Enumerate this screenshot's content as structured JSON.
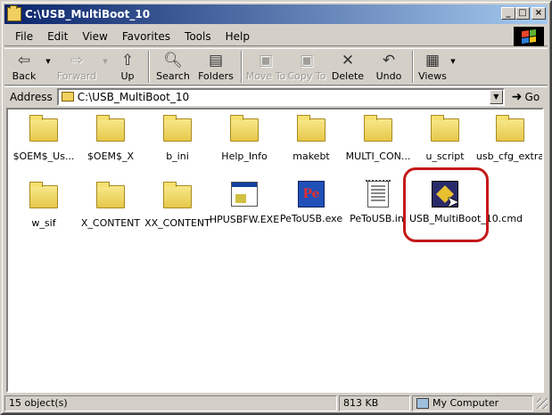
{
  "window": {
    "title": "C:\\USB_MultiBoot_10",
    "minimize": "_",
    "maximize": "□",
    "close": "×"
  },
  "menu": [
    "File",
    "Edit",
    "View",
    "Favorites",
    "Tools",
    "Help"
  ],
  "toolbar": {
    "back": "Back",
    "forward": "Forward",
    "up": "Up",
    "search": "Search",
    "folders": "Folders",
    "move_to": "Move To",
    "copy_to": "Copy To",
    "delete": "Delete",
    "undo": "Undo",
    "views": "Views"
  },
  "address": {
    "label": "Address",
    "value": "C:\\USB_MultiBoot_10",
    "go": "Go"
  },
  "items": [
    {
      "label": "$OEM$_Us...",
      "type": "folder-icon"
    },
    {
      "label": "$OEM$_X",
      "type": "folder-icon"
    },
    {
      "label": "b_ini",
      "type": "folder-icon"
    },
    {
      "label": "Help_Info",
      "type": "folder-icon"
    },
    {
      "label": "makebt",
      "type": "folder-icon"
    },
    {
      "label": "MULTI_CON...",
      "type": "folder-icon"
    },
    {
      "label": "u_script",
      "type": "folder-icon"
    },
    {
      "label": "usb_cfg_extra",
      "type": "folder-icon"
    },
    {
      "label": "w_sif",
      "type": "folder-icon"
    },
    {
      "label": "X_CONTENT",
      "type": "folder-icon"
    },
    {
      "label": "XX_CONTENT",
      "type": "folder-icon"
    },
    {
      "label": "HPUSBFW.EXE",
      "type": "exe-icon"
    },
    {
      "label": "PeToUSB.exe",
      "type": "app-icon"
    },
    {
      "label": "PeToUSB.ini",
      "type": "ini-icon"
    },
    {
      "label": "USB_MultiBoot_10.cmd",
      "type": "cmd-icon"
    }
  ],
  "status": {
    "objects": "15 object(s)",
    "size": "813 KB",
    "location": "My Computer"
  },
  "colors": {
    "titlebar_start": "#0a246a",
    "titlebar_end": "#a6caf0",
    "highlight_ring": "#c41818",
    "chrome": "#d4d0c8"
  }
}
